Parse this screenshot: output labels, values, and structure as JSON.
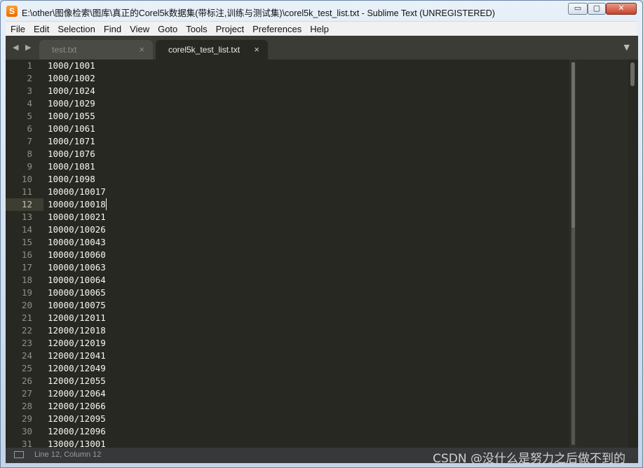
{
  "window": {
    "title": "E:\\other\\图像检索\\图库\\真正的Corel5k数据集(带标注,训练与测试集)\\corel5k_test_list.txt - Sublime Text (UNREGISTERED)",
    "app_icon": "sublime-text-icon",
    "min_glyph": "▭",
    "max_glyph": "▢",
    "close_glyph": "✕"
  },
  "menu": [
    "File",
    "Edit",
    "Selection",
    "Find",
    "View",
    "Goto",
    "Tools",
    "Project",
    "Preferences",
    "Help"
  ],
  "tabs": {
    "nav_glyph": "◀ ▶",
    "items": [
      {
        "label": "test.txt",
        "close": "×"
      },
      {
        "label": "corel5k_test_list.txt",
        "close": "×"
      }
    ],
    "dropdown_glyph": "▼"
  },
  "editor": {
    "current_line": 12,
    "lines": [
      {
        "num": "1",
        "text": "1000/1001"
      },
      {
        "num": "2",
        "text": "1000/1002"
      },
      {
        "num": "3",
        "text": "1000/1024"
      },
      {
        "num": "4",
        "text": "1000/1029"
      },
      {
        "num": "5",
        "text": "1000/1055"
      },
      {
        "num": "6",
        "text": "1000/1061"
      },
      {
        "num": "7",
        "text": "1000/1071"
      },
      {
        "num": "8",
        "text": "1000/1076"
      },
      {
        "num": "9",
        "text": "1000/1081"
      },
      {
        "num": "10",
        "text": "1000/1098"
      },
      {
        "num": "11",
        "text": "10000/10017"
      },
      {
        "num": "12",
        "text": "10000/10018"
      },
      {
        "num": "13",
        "text": "10000/10021"
      },
      {
        "num": "14",
        "text": "10000/10026"
      },
      {
        "num": "15",
        "text": "10000/10043"
      },
      {
        "num": "16",
        "text": "10000/10060"
      },
      {
        "num": "17",
        "text": "10000/10063"
      },
      {
        "num": "18",
        "text": "10000/10064"
      },
      {
        "num": "19",
        "text": "10000/10065"
      },
      {
        "num": "20",
        "text": "10000/10075"
      },
      {
        "num": "21",
        "text": "12000/12011"
      },
      {
        "num": "22",
        "text": "12000/12018"
      },
      {
        "num": "23",
        "text": "12000/12019"
      },
      {
        "num": "24",
        "text": "12000/12041"
      },
      {
        "num": "25",
        "text": "12000/12049"
      },
      {
        "num": "26",
        "text": "12000/12055"
      },
      {
        "num": "27",
        "text": "12000/12064"
      },
      {
        "num": "28",
        "text": "12000/12066"
      },
      {
        "num": "29",
        "text": "12000/12095"
      },
      {
        "num": "30",
        "text": "12000/12096"
      },
      {
        "num": "31",
        "text": "13000/13001"
      }
    ]
  },
  "status": {
    "position": "Line 12, Column 12",
    "watermark": "CSDN @没什么是努力之后做不到的"
  },
  "colors": {
    "editor_bg": "#272822",
    "text": "#f8f8f2",
    "line_numbers": "#8f908a",
    "current_line_bg": "#3e3d32"
  }
}
